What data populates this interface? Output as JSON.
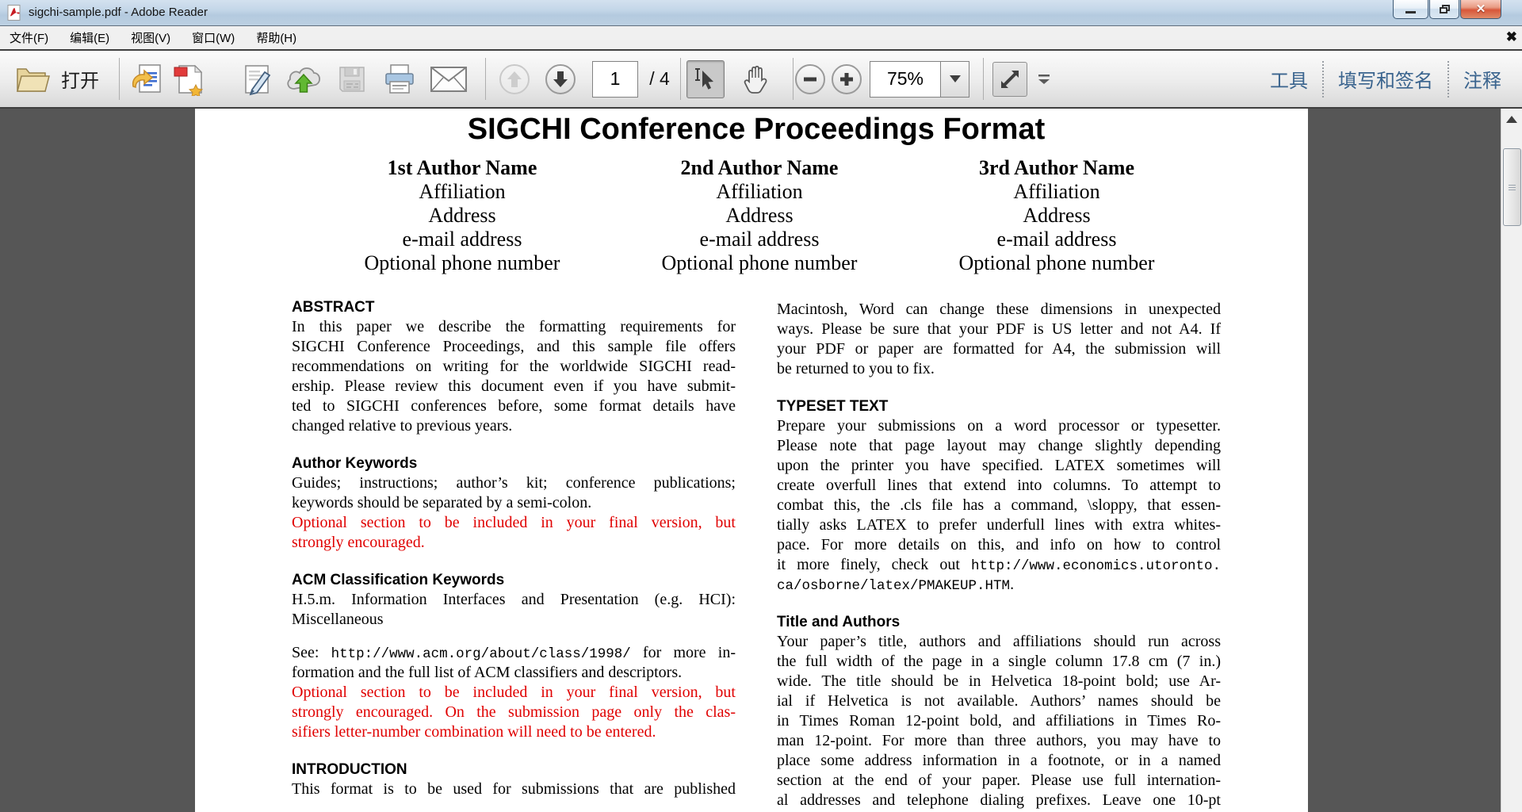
{
  "window": {
    "title": "sigchi-sample.pdf - Adobe Reader",
    "controls": {
      "minimize": "minimize",
      "restore": "restore",
      "close": "close",
      "close_glyph": "✕"
    }
  },
  "menu": {
    "items": [
      "文件(F)",
      "编辑(E)",
      "视图(V)",
      "窗口(W)",
      "帮助(H)"
    ],
    "close_document_glyph": "✖"
  },
  "toolbar": {
    "open_label": "打开",
    "page_number": "1",
    "page_count_label": "/ 4",
    "zoom_level": "75%",
    "icon_names": [
      "open-folder-icon",
      "export-pdf-icon",
      "create-pdf-icon",
      "sign-icon",
      "cloud-upload-icon",
      "save-icon",
      "print-icon",
      "email-icon",
      "page-up-icon",
      "page-down-icon",
      "select-tool-icon",
      "hand-tool-icon",
      "zoom-out-icon",
      "zoom-in-icon",
      "fit-width-icon",
      "toolbar-more-icon"
    ],
    "tabs": [
      "工具",
      "填写和签名",
      "注释"
    ]
  },
  "document": {
    "title": "SIGCHI Conference Proceedings Format",
    "authors": [
      {
        "name": "1st Author Name",
        "lines": [
          "Affiliation",
          "Address",
          "e-mail address",
          "Optional phone number"
        ]
      },
      {
        "name": "2nd Author Name",
        "lines": [
          "Affiliation",
          "Address",
          "e-mail address",
          "Optional phone number"
        ]
      },
      {
        "name": "3rd Author Name",
        "lines": [
          "Affiliation",
          "Address",
          "e-mail address",
          "Optional phone number"
        ]
      }
    ],
    "left_column": {
      "sections": [
        {
          "heading": "ABSTRACT",
          "paragraphs": [
            {
              "lines": [
                "In this paper we describe the formatting requirements for",
                "SIGCHI Conference Proceedings, and this sample file offers",
                "recommendations on writing for the worldwide SIGCHI read-",
                "ership. Please review this document even if you have submit-",
                "ted to SIGCHI conferences before, some format details have",
                "changed relative to previous years."
              ]
            }
          ]
        },
        {
          "heading": "Author Keywords",
          "paragraphs": [
            {
              "lines": [
                "Guides; instructions; author’s kit; conference publications;",
                "keywords should be separated by a semi-colon."
              ]
            },
            {
              "red": true,
              "lines": [
                "Optional section to be included in your final version, but",
                "strongly encouraged."
              ]
            }
          ]
        },
        {
          "heading": "ACM Classification Keywords",
          "paragraphs": [
            {
              "lines": [
                "H.5.m.  Information Interfaces and Presentation (e.g.  HCI):",
                "Miscellaneous"
              ]
            },
            {
              "gap": true,
              "lines": [
                [
                  "See: ",
                  {
                    "t": "http://www.acm.org/about/class/1998/",
                    "mono": true
                  },
                  " for more in-"
                ],
                "formation and the full list of ACM classifiers and descriptors."
              ]
            },
            {
              "red": true,
              "lines": [
                "Optional section to be included in your final version, but",
                "strongly encouraged.  On the submission page only the clas-",
                "sifiers letter-number combination will need to be entered."
              ]
            }
          ]
        },
        {
          "heading": "INTRODUCTION",
          "paragraphs": [
            {
              "cont": true,
              "lines": [
                "This format is to be used for submissions that are published"
              ]
            }
          ]
        }
      ]
    },
    "right_column": {
      "sections": [
        {
          "heading": null,
          "paragraphs": [
            {
              "lines": [
                "Macintosh, Word can change these dimensions in unexpected",
                "ways.  Please be sure that your PDF is US letter and not A4. If",
                "your PDF or paper are formatted for A4, the submission will",
                "be returned to you to fix."
              ]
            }
          ]
        },
        {
          "heading": "TYPESET TEXT",
          "paragraphs": [
            {
              "lines": [
                "Prepare your submissions on a word processor or typesetter.",
                "Please note that page layout may change slightly depending",
                "upon the printer you have specified.  LATEX sometimes will",
                "create overfull lines that extend into columns.  To attempt to",
                "combat this, the .cls file has a command, \\sloppy, that essen-",
                "tially asks LATEX to prefer underfull lines with extra whites-",
                "pace.  For more details on this, and info on how to control",
                [
                  "it more finely, check out ",
                  {
                    "t": "http://www.economics.utoronto.",
                    "mono": true
                  }
                ],
                [
                  {
                    "t": "ca/osborne/latex/PMAKEUP.HTM",
                    "mono": true
                  },
                  "."
                ]
              ]
            }
          ]
        },
        {
          "heading": "Title and Authors",
          "paragraphs": [
            {
              "cont": true,
              "lines": [
                "Your paper’s title, authors and affiliations should run across",
                "the full width of the page in a single column 17.8 cm (7 in.)",
                "wide.  The title should be in Helvetica 18-point bold; use Ar-",
                "ial if Helvetica is not available.  Authors’ names should be",
                "in Times Roman 12-point bold, and affiliations in Times Ro-",
                "man 12-point.  For more than three authors, you may have to",
                "place some address information in a footnote, or in a named",
                "section at the end of your paper.  Please use full internation-",
                "al addresses and telephone dialing prefixes.  Leave one 10-pt"
              ]
            }
          ]
        }
      ]
    }
  }
}
